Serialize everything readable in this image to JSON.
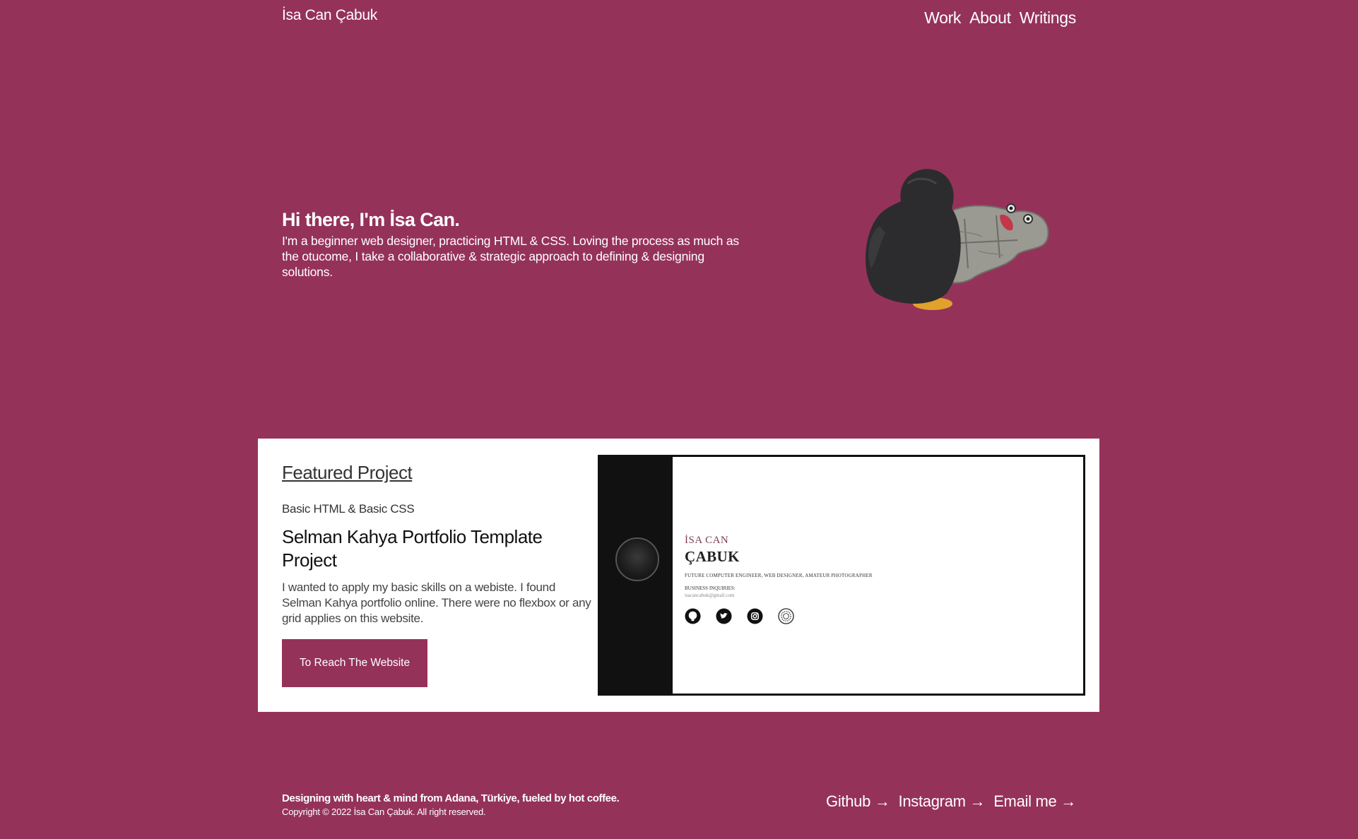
{
  "header": {
    "brand": "İsa Can Çabuk",
    "nav": [
      {
        "label": "Work"
      },
      {
        "label": "About"
      },
      {
        "label": "Writings"
      }
    ]
  },
  "hero": {
    "title": "Hi there, I'm İsa Can.",
    "text": "I'm a beginner web designer, practicing HTML & CSS. Loving the process as much as the otucome, I take a collaborative & strategic approach to defining & designing solutions.",
    "image_icon": "plush-penguin-illustration"
  },
  "featured": {
    "heading": "Featured Project",
    "skills": "Basic HTML & Basic CSS",
    "project_title": "Selman Kahya Portfolio Template Project",
    "description": "I wanted to apply my basic skills on a webiste. I found Selman Kahya portfolio online. There were no flexbox or any grid applies on this website.",
    "button_label": "To Reach The Website",
    "preview": {
      "first_name": "İSA CAN",
      "last_name": "ÇABUK",
      "roles": "FUTURE COMPUTER ENGINEER, WEB DESIGNER, AMATEUR PHOTOGRAPHER",
      "business_label": "BUSINESS INQUIRIES:",
      "email": "isacancabuk@gmail.com",
      "icons": [
        "github-icon",
        "twitter-icon",
        "instagram-icon",
        "vsco-icon"
      ]
    }
  },
  "footer": {
    "tagline": "Designing with heart & mind from Adana, Türkiye, fueled by hot coffee.",
    "copyright": "Copyright © 2022 İsa Can Çabuk. All right reserved.",
    "links": [
      {
        "label": "Github →"
      },
      {
        "label": "Instagram →"
      },
      {
        "label": "Email me →"
      }
    ]
  },
  "colors": {
    "background": "#95325a",
    "card": "#ffffff",
    "button": "#95325a"
  }
}
